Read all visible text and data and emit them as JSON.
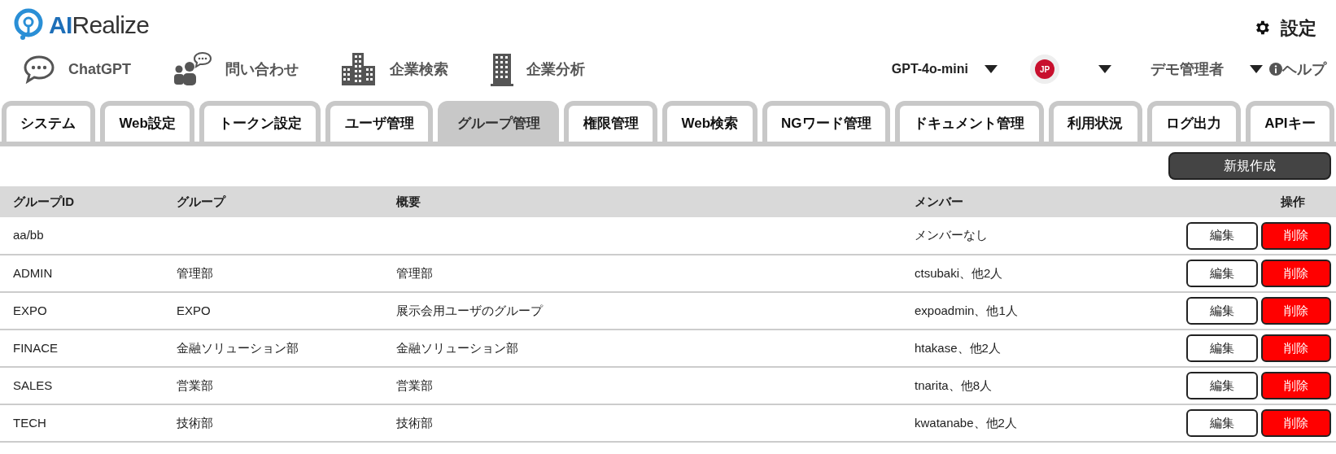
{
  "header": {
    "logo": {
      "prefix": "AI",
      "rest": "Realize"
    },
    "settings": "設定"
  },
  "nav": [
    {
      "label": "ChatGPT",
      "kind": "chat"
    },
    {
      "label": "問い合わせ",
      "kind": "contact"
    },
    {
      "label": "企業検索",
      "kind": "search"
    },
    {
      "label": "企業分析",
      "kind": "analysis"
    }
  ],
  "model": "GPT-4o-mini",
  "language": "JP",
  "user": "デモ管理者",
  "help": "ヘルプ",
  "tabs": [
    {
      "label": "システム",
      "selected": false
    },
    {
      "label": "Web設定",
      "selected": false
    },
    {
      "label": "トークン設定",
      "selected": false
    },
    {
      "label": "ユーザ管理",
      "selected": false
    },
    {
      "label": "グループ管理",
      "selected": true
    },
    {
      "label": "権限管理",
      "selected": false
    },
    {
      "label": "Web検索",
      "selected": false
    },
    {
      "label": "NGワード管理",
      "selected": false
    },
    {
      "label": "ドキュメント管理",
      "selected": false
    },
    {
      "label": "利用状況",
      "selected": false
    },
    {
      "label": "ログ出力",
      "selected": false
    },
    {
      "label": "APIキー",
      "selected": false
    }
  ],
  "new_button": "新規作成",
  "table": {
    "columns": [
      "グループID",
      "グループ",
      "概要",
      "メンバー",
      "操作"
    ],
    "rows": [
      {
        "id": "aa/bb",
        "group": "",
        "summary": "",
        "members": "メンバーなし",
        "edit": "編集",
        "delete": "削除"
      },
      {
        "id": "ADMIN",
        "group": "管理部",
        "summary": "管理部",
        "members": "ctsubaki、他2人",
        "edit": "編集",
        "delete": "削除"
      },
      {
        "id": "EXPO",
        "group": "EXPO",
        "summary": "展示会用ユーザのグループ",
        "members": "expoadmin、他1人",
        "edit": "編集",
        "delete": "削除"
      },
      {
        "id": "FINACE",
        "group": "金融ソリューション部",
        "summary": "金融ソリューション部",
        "members": "htakase、他2人",
        "edit": "編集",
        "delete": "削除"
      },
      {
        "id": "SALES",
        "group": "営業部",
        "summary": "営業部",
        "members": "tnarita、他8人",
        "edit": "編集",
        "delete": "削除"
      },
      {
        "id": "TECH",
        "group": "技術部",
        "summary": "技術部",
        "members": "kwatanabe、他2人",
        "edit": "編集",
        "delete": "削除"
      }
    ]
  }
}
